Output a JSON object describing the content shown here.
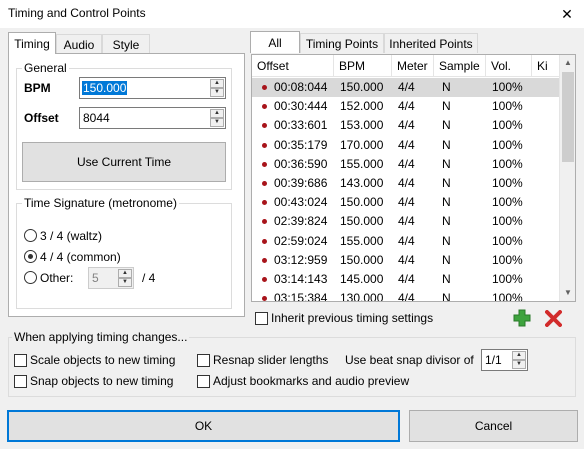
{
  "window": {
    "title": "Timing and Control Points",
    "close_glyph": "✕"
  },
  "left_tabs": [
    "Timing",
    "Audio",
    "Style"
  ],
  "general": {
    "group_label": "General",
    "bpm_label": "BPM",
    "bpm_value": "150.000",
    "offset_label": "Offset",
    "offset_value": "8044",
    "use_current_time": "Use Current Time"
  },
  "time_signature": {
    "group_label": "Time Signature (metronome)",
    "options": [
      "3 / 4 (waltz)",
      "4 / 4 (common)",
      "Other:"
    ],
    "selected": "4 / 4 (common)",
    "other_value": "5",
    "other_suffix": "/ 4"
  },
  "right_tabs": [
    "All",
    "Timing Points",
    "Inherited Points"
  ],
  "list": {
    "columns": [
      "Offset",
      "BPM",
      "Meter",
      "Sample",
      "Vol.",
      "Ki"
    ],
    "rows": [
      {
        "offset": "00:08:044",
        "bpm": "150.000",
        "meter": "4/4",
        "sample": "N",
        "vol": "100%"
      },
      {
        "offset": "00:30:444",
        "bpm": "152.000",
        "meter": "4/4",
        "sample": "N",
        "vol": "100%"
      },
      {
        "offset": "00:33:601",
        "bpm": "153.000",
        "meter": "4/4",
        "sample": "N",
        "vol": "100%"
      },
      {
        "offset": "00:35:179",
        "bpm": "170.000",
        "meter": "4/4",
        "sample": "N",
        "vol": "100%"
      },
      {
        "offset": "00:36:590",
        "bpm": "155.000",
        "meter": "4/4",
        "sample": "N",
        "vol": "100%"
      },
      {
        "offset": "00:39:686",
        "bpm": "143.000",
        "meter": "4/4",
        "sample": "N",
        "vol": "100%"
      },
      {
        "offset": "00:43:024",
        "bpm": "150.000",
        "meter": "4/4",
        "sample": "N",
        "vol": "100%"
      },
      {
        "offset": "02:39:824",
        "bpm": "150.000",
        "meter": "4/4",
        "sample": "N",
        "vol": "100%"
      },
      {
        "offset": "02:59:024",
        "bpm": "155.000",
        "meter": "4/4",
        "sample": "N",
        "vol": "100%"
      },
      {
        "offset": "03:12:959",
        "bpm": "150.000",
        "meter": "4/4",
        "sample": "N",
        "vol": "100%"
      },
      {
        "offset": "03:14:143",
        "bpm": "145.000",
        "meter": "4/4",
        "sample": "N",
        "vol": "100%"
      },
      {
        "offset": "03:15:384",
        "bpm": "130.000",
        "meter": "4/4",
        "sample": "N",
        "vol": "100%"
      }
    ],
    "selected_index": 0
  },
  "inherit_label": "Inherit previous timing settings",
  "icons": {
    "add": "add-icon",
    "delete": "delete-icon",
    "add_color": "#3ea33e",
    "delete_color": "#d22b2b",
    "point_color": "#a8141b"
  },
  "changes": {
    "group_label": "When applying timing changes...",
    "scale_objects": "Scale objects to new timing",
    "snap_objects": "Snap objects to new timing",
    "resnap_sliders": "Resnap slider lengths",
    "adjust_bookmarks": "Adjust bookmarks and audio preview",
    "beat_snap_label": "Use beat snap divisor of",
    "beat_snap_value": "1/1"
  },
  "buttons": {
    "ok": "OK",
    "cancel": "Cancel"
  }
}
